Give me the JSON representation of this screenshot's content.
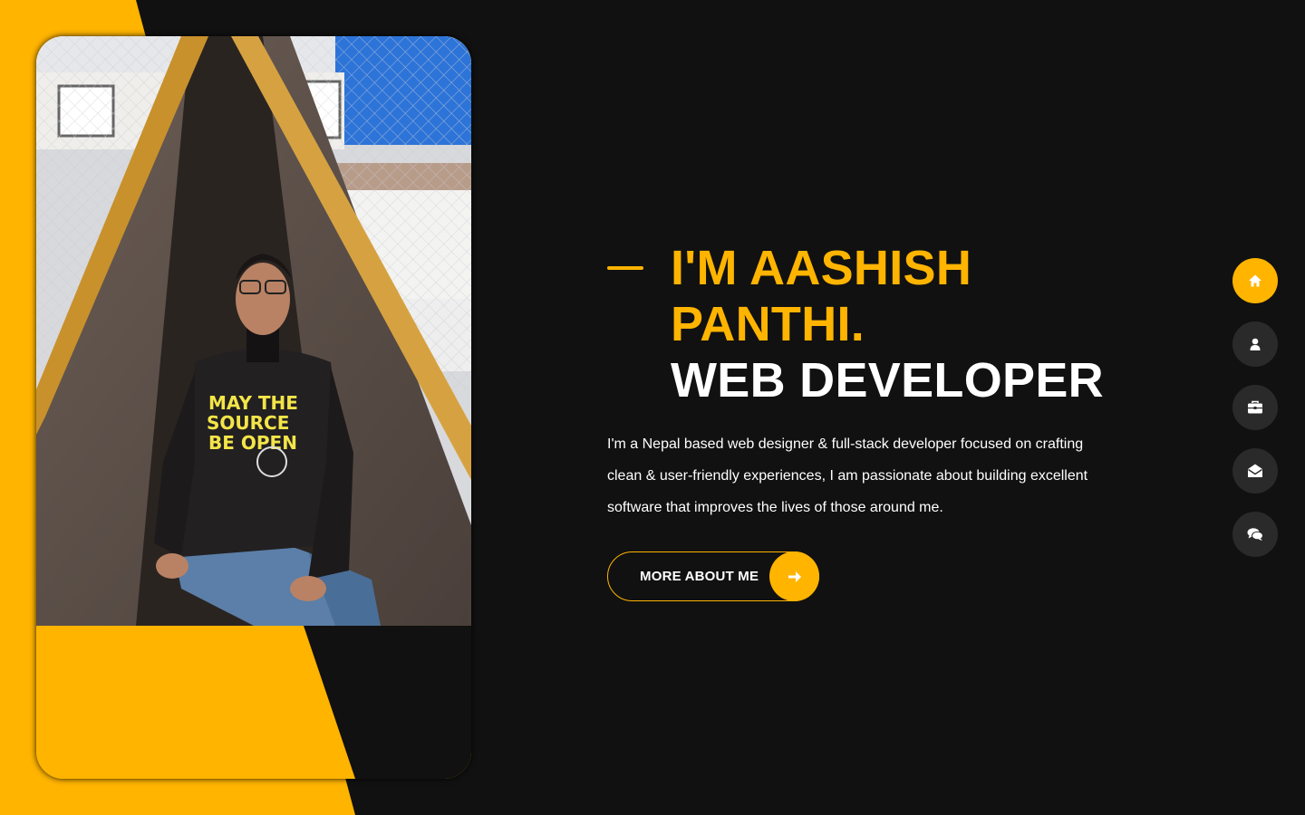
{
  "theme": {
    "accent": "#ffb400",
    "background": "#111111",
    "nav_button": "#2b2a2a",
    "text": "#ffffff"
  },
  "hero": {
    "title_line1": "I'm Aashish",
    "title_line2": "Panthi.",
    "title_role": "Web Developer",
    "intro": "I'm a Nepal based web designer & full-stack developer focused on crafting clean & user-friendly experiences, I am passionate about building excellent software that improves the lives of those around me.",
    "cta_label": "More About Me",
    "cta_icon": "arrow-right-icon"
  },
  "photo": {
    "shirt_text_line1": "MAY THE",
    "shirt_text_line2": "SOURCE",
    "shirt_text_line3": "BE OPEN"
  },
  "nav": [
    {
      "icon": "home-icon",
      "active": true
    },
    {
      "icon": "user-icon",
      "active": false
    },
    {
      "icon": "briefcase-icon",
      "active": false
    },
    {
      "icon": "envelope-open-icon",
      "active": false
    },
    {
      "icon": "comments-icon",
      "active": false
    }
  ]
}
